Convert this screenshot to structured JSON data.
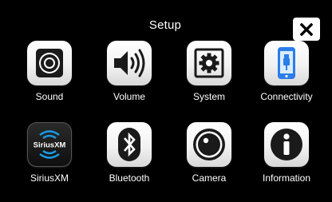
{
  "header": {
    "title": "Setup",
    "close_icon": "close-icon"
  },
  "menu": {
    "items": [
      {
        "label": "Sound",
        "icon": "speaker-icon"
      },
      {
        "label": "Volume",
        "icon": "volume-icon"
      },
      {
        "label": "System",
        "icon": "gear-icon"
      },
      {
        "label": "Connectivity",
        "icon": "phone-usb-icon"
      },
      {
        "label": "SiriusXM",
        "icon": "siriusxm-logo",
        "logo_text": "SiriusXM"
      },
      {
        "label": "Bluetooth",
        "icon": "bluetooth-icon"
      },
      {
        "label": "Camera",
        "icon": "camera-icon"
      },
      {
        "label": "Information",
        "icon": "info-icon"
      }
    ]
  },
  "colors": {
    "background": "#000000",
    "tile": "#ffffff",
    "icon": "#111111",
    "connectivity_accent": "#2b7de9",
    "siriusxm_accent": "#1a9be6"
  }
}
